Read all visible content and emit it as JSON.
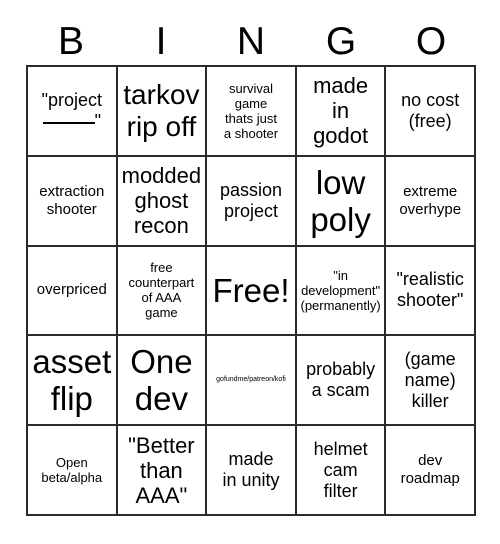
{
  "card": {
    "header_letters": [
      "B",
      "I",
      "N",
      "G",
      "O"
    ],
    "columns": 5,
    "rows": 5,
    "border_color": "#2b2b2b",
    "background_color": "#ffffff",
    "text_color": "#000000",
    "cells": [
      {
        "text": "\"project\n____\"",
        "size": "md"
      },
      {
        "text": "tarkov\nrip off",
        "size": "xl"
      },
      {
        "text": "survival\ngame\nthats just\na shooter",
        "size": "xs"
      },
      {
        "text": "made\nin\ngodot",
        "size": "lg"
      },
      {
        "text": "no cost\n(free)",
        "size": "md"
      },
      {
        "text": "extraction\nshooter",
        "size": "sm"
      },
      {
        "text": "modded\nghost\nrecon",
        "size": "lg"
      },
      {
        "text": "passion\nproject",
        "size": "md"
      },
      {
        "text": "low\npoly",
        "size": "xxl"
      },
      {
        "text": "extreme\noverhype",
        "size": "sm"
      },
      {
        "text": "overpriced",
        "size": "sm"
      },
      {
        "text": "free\ncounterpart\nof AAA\ngame",
        "size": "xs"
      },
      {
        "text": "Free!",
        "size": "xxl"
      },
      {
        "text": "\"in\ndevelopment\"\n(permanently)",
        "size": "xs"
      },
      {
        "text": "\"realistic\nshooter\"",
        "size": "md"
      },
      {
        "text": "asset\nflip",
        "size": "xxl"
      },
      {
        "text": "One\ndev",
        "size": "xxl"
      },
      {
        "text": "gofundme/patreon/kofi",
        "size": "xxs"
      },
      {
        "text": "probably\na scam",
        "size": "md"
      },
      {
        "text": "(game\nname)\nkiller",
        "size": "md"
      },
      {
        "text": "Open\nbeta/alpha",
        "size": "xs"
      },
      {
        "text": "\"Better\nthan\nAAA\"",
        "size": "lg"
      },
      {
        "text": "made\nin unity",
        "size": "md"
      },
      {
        "text": "helmet\ncam\nfilter",
        "size": "md"
      },
      {
        "text": "dev\nroadmap",
        "size": "sm"
      }
    ]
  }
}
